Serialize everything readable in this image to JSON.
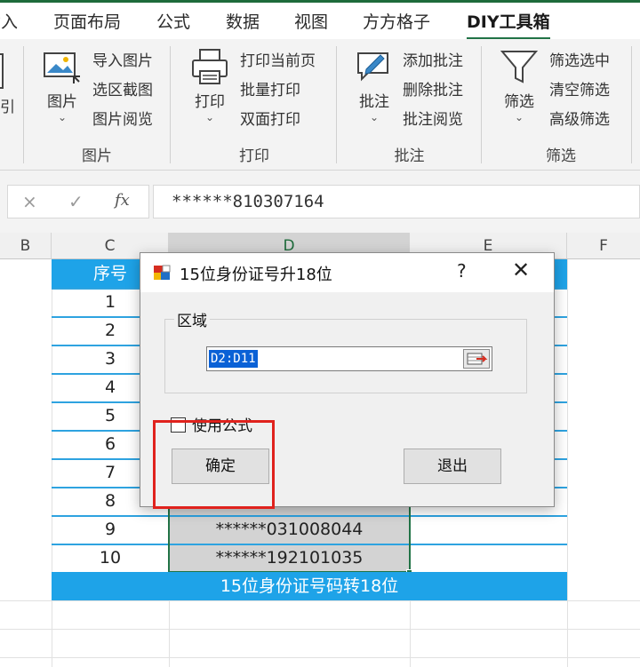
{
  "ribbon_tabs": [
    "插入",
    "页面布局",
    "公式",
    "数据",
    "视图",
    "方方格子",
    "DIY工具箱"
  ],
  "active_tab": "DIY工具箱",
  "groups": {
    "picture": {
      "label": "图片",
      "big_button": "图片",
      "items": [
        "导入图片",
        "选区截图",
        "图片阅览"
      ]
    },
    "print": {
      "label": "打印",
      "big_button": "打印",
      "items": [
        "打印当前页",
        "批量打印",
        "双面打印"
      ]
    },
    "comment": {
      "label": "批注",
      "big_button": "批注",
      "items": [
        "添加批注",
        "删除批注",
        "批注阅览"
      ]
    },
    "filter": {
      "label": "筛选",
      "big_button": "筛选",
      "items": [
        "筛选选中",
        "清空筛选",
        "高级筛选"
      ]
    },
    "partial_left_label": "引"
  },
  "formula_bar": {
    "cancel_glyph": "×",
    "enter_glyph": "✓",
    "fx_label": "fx",
    "content": "******810307164"
  },
  "columns": [
    "B",
    "C",
    "D",
    "E",
    "F"
  ],
  "table": {
    "header": "序号",
    "rows": [
      {
        "index": "1",
        "id": ""
      },
      {
        "index": "2",
        "id": ""
      },
      {
        "index": "3",
        "id": ""
      },
      {
        "index": "4",
        "id": ""
      },
      {
        "index": "5",
        "id": ""
      },
      {
        "index": "6",
        "id": ""
      },
      {
        "index": "7",
        "id": ""
      },
      {
        "index": "8",
        "id": ""
      },
      {
        "index": "9",
        "id": "******031008044"
      },
      {
        "index": "10",
        "id": "******192101035"
      }
    ],
    "footer": "15位身份证号码转18位"
  },
  "dialog": {
    "title": "15位身份证号升18位",
    "help": "?",
    "close": "✕",
    "group_label": "区域",
    "range_value": "D2:D11",
    "checkbox_label": "使用公式",
    "checkbox_checked": false,
    "ok_label": "确定",
    "exit_label": "退出"
  },
  "colors": {
    "accent_green": "#217346",
    "table_header_blue": "#1ea3e8",
    "highlight_red": "#e0221d"
  }
}
